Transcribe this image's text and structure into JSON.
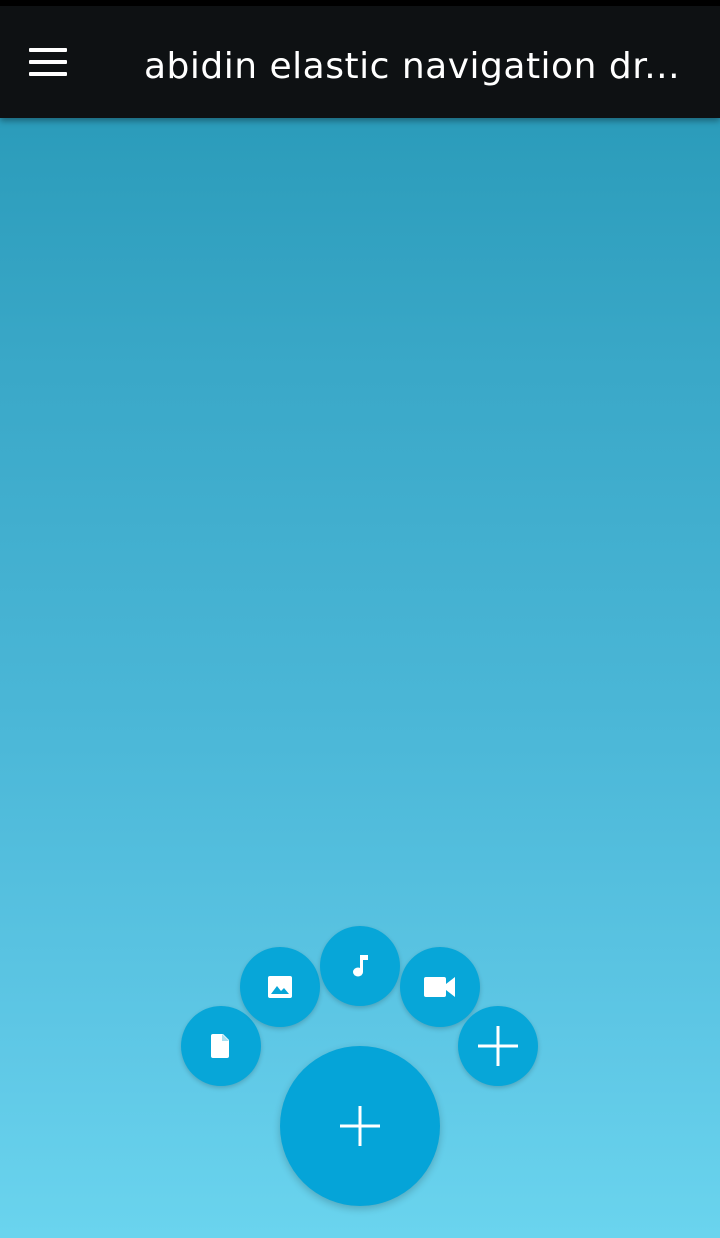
{
  "toolbar": {
    "title": "abidin elastic navigation dr...",
    "menu_icon": "hamburger-menu-icon",
    "background_color": "#0e1113"
  },
  "fab_menu": {
    "accent_color": "#07a6d8",
    "items": [
      {
        "name": "file",
        "icon": "file-icon"
      },
      {
        "name": "image",
        "icon": "image-icon"
      },
      {
        "name": "music",
        "icon": "music-note-icon"
      },
      {
        "name": "video",
        "icon": "video-camera-icon"
      },
      {
        "name": "add",
        "icon": "plus-icon"
      }
    ],
    "main_button_icon": "plus-icon"
  }
}
